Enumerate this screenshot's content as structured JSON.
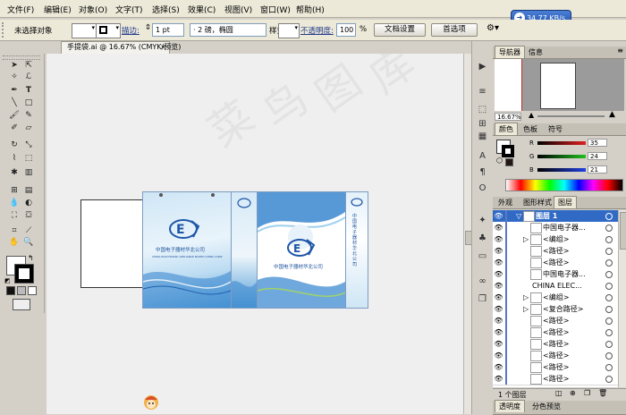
{
  "menubar": {
    "items": [
      {
        "label": "文件(F)"
      },
      {
        "label": "编辑(E)"
      },
      {
        "label": "对象(O)"
      },
      {
        "label": "文字(T)"
      },
      {
        "label": "选择(S)"
      },
      {
        "label": "效果(C)"
      },
      {
        "label": "视图(V)"
      },
      {
        "label": "窗口(W)"
      },
      {
        "label": "帮助(H)"
      }
    ]
  },
  "speed_badge": "34.77 KB/s",
  "control_bar": {
    "selection_label": "未选择对象",
    "stroke_label": "描边:",
    "stroke_width": "1 pt",
    "brush_label": "· 2 磅，椭圆",
    "style_label": "样式:",
    "opacity_label": "不透明度:",
    "opacity_value": "100",
    "opacity_unit": "%",
    "doc_setup_button": "文档设置",
    "prefs_button": "首选项"
  },
  "document": {
    "tab_title": "手提袋.ai @ 16.67% (CMYK/预览)",
    "tab_close": "×"
  },
  "artwork": {
    "company_cn": "中国电子器材华北公司",
    "company_en": "CHINA ELECTRONIC APPLIANCE NORTH-CHINA CORP",
    "side_text": "中国电子器材华北公司",
    "watermark_chars": [
      "菜",
      "鸟",
      "图",
      "库"
    ]
  },
  "navigator": {
    "tabs": [
      {
        "label": "导航器"
      },
      {
        "label": "信息"
      }
    ],
    "zoom": "16.67%"
  },
  "color": {
    "tabs": [
      {
        "label": "颜色"
      },
      {
        "label": "色板"
      },
      {
        "label": "符号"
      }
    ],
    "channels": [
      {
        "label": "R",
        "value": "35",
        "color": "#e02020"
      },
      {
        "label": "G",
        "value": "24",
        "color": "#20c020"
      },
      {
        "label": "B",
        "value": "21",
        "color": "#2040e0"
      }
    ]
  },
  "layers": {
    "tabs": [
      {
        "label": "外观"
      },
      {
        "label": "图形样式"
      },
      {
        "label": "图层"
      }
    ],
    "rows": [
      {
        "label": "图层 1",
        "selected": true,
        "expand": "▽"
      },
      {
        "label": "中国电子器...",
        "selected": false,
        "expand": ""
      },
      {
        "label": "<编组>",
        "selected": false,
        "expand": "▷"
      },
      {
        "label": "<路径>",
        "selected": false,
        "expand": ""
      },
      {
        "label": "<路径>",
        "selected": false,
        "expand": ""
      },
      {
        "label": "中国电子器...",
        "selected": false,
        "expand": ""
      },
      {
        "label": "CHINA ELEC...",
        "selected": false,
        "expand": ""
      },
      {
        "label": "<编组>",
        "selected": false,
        "expand": "▷"
      },
      {
        "label": "<复合路径>",
        "selected": false,
        "expand": "▷"
      },
      {
        "label": "<路径>",
        "selected": false,
        "expand": ""
      },
      {
        "label": "<路径>",
        "selected": false,
        "expand": ""
      },
      {
        "label": "<路径>",
        "selected": false,
        "expand": ""
      },
      {
        "label": "<路径>",
        "selected": false,
        "expand": ""
      },
      {
        "label": "<路径>",
        "selected": false,
        "expand": ""
      },
      {
        "label": "<路径>",
        "selected": false,
        "expand": ""
      }
    ],
    "footer": "1 个图层"
  },
  "bottom_tabs": [
    {
      "label": "透明度"
    },
    {
      "label": "分色预览"
    }
  ],
  "colors": {
    "accent": "#316ac5",
    "bag_blue": "#2c6fb8",
    "layer_mark": "#5a78c4"
  }
}
